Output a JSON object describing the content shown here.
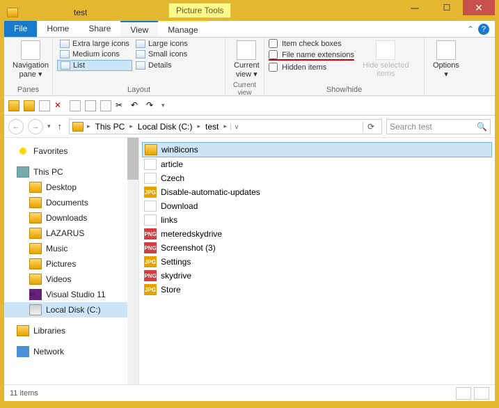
{
  "window": {
    "title": "test",
    "context_tab": "Picture Tools",
    "minimize": "—",
    "maximize": "☐",
    "close": "✕"
  },
  "menubar": {
    "file": "File",
    "tabs": [
      "Home",
      "Share",
      "View",
      "Manage"
    ],
    "collapse": "⌃",
    "help": "?"
  },
  "ribbon": {
    "panes": {
      "nav_pane": "Navigation\npane ▾",
      "label": "Panes"
    },
    "layout": {
      "items": [
        "Extra large icons",
        "Large icons",
        "Medium icons",
        "Small icons",
        "List",
        "Details"
      ],
      "label": "Layout"
    },
    "current_view": {
      "btn": "Current\nview ▾",
      "label": "Current view"
    },
    "showhide": {
      "checks": [
        "Item check boxes",
        "File name extensions",
        "Hidden items"
      ],
      "hide_btn": "Hide selected\nitems",
      "label": "Show/hide"
    },
    "options": {
      "btn": "Options\n▾"
    }
  },
  "nav": {
    "back": "←",
    "forward": "→",
    "history": "▾",
    "up": "↑",
    "crumbs": [
      "This PC",
      "Local Disk (C:)",
      "test"
    ],
    "refresh": "⟳",
    "search_placeholder": "Search test"
  },
  "tree": {
    "favorites": "Favorites",
    "thispc": "This PC",
    "items": [
      "Desktop",
      "Documents",
      "Downloads",
      "LAZARUS",
      "Music",
      "Pictures",
      "Videos",
      "Visual Studio 11",
      "Local Disk (C:)"
    ],
    "libraries": "Libraries",
    "network": "Network"
  },
  "files": [
    {
      "name": "win8icons",
      "type": "folder",
      "sel": true
    },
    {
      "name": "article",
      "type": "doc"
    },
    {
      "name": "Czech",
      "type": "doc"
    },
    {
      "name": "Disable-automatic-updates",
      "type": "jpg"
    },
    {
      "name": "Download",
      "type": "doc"
    },
    {
      "name": "links",
      "type": "doc"
    },
    {
      "name": "meteredskydrive",
      "type": "png"
    },
    {
      "name": "Screenshot (3)",
      "type": "png"
    },
    {
      "name": "Settings",
      "type": "jpg"
    },
    {
      "name": "skydrive",
      "type": "png"
    },
    {
      "name": "Store",
      "type": "jpg"
    }
  ],
  "status": {
    "count": "11 items"
  }
}
